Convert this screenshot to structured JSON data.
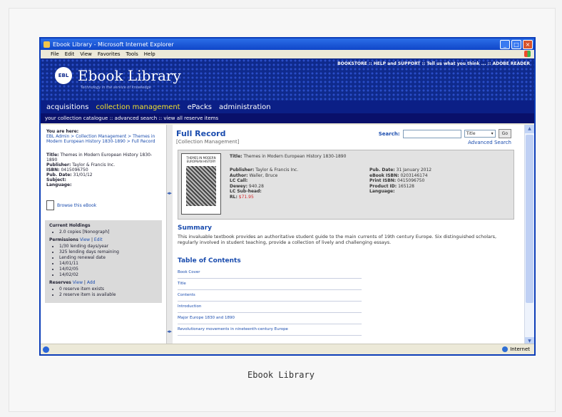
{
  "window": {
    "title": "Ebook Library - Microsoft Internet Explorer",
    "menu": [
      "File",
      "Edit",
      "View",
      "Favorites",
      "Tools",
      "Help"
    ]
  },
  "site": {
    "logo_badge": "EBL",
    "logo_name": "Ebook Library",
    "tagline": "Technology in the service of knowledge",
    "top_links": "BOOKSTORE :: HELP and SUPPORT :: Tell us what you think ... :: ADOBE READER",
    "main_nav": [
      "acquisitions",
      "collection management",
      "ePacks",
      "administration"
    ],
    "active_nav": "collection management",
    "sub_nav": "your collection catalogue :: advanced search :: view all reserve items"
  },
  "sidebar": {
    "you_are_here_label": "You are here:",
    "breadcrumb": "EBL Admin > Collection Management > Themes in Modern European History 1830-1890 > Full Record",
    "meta": [
      {
        "label": "Title:",
        "value": "Themes in Modern European History 1830-1890"
      },
      {
        "label": "Publisher:",
        "value": "Taylor & Francis Inc."
      },
      {
        "label": "ISBN:",
        "value": "0415096750"
      },
      {
        "label": "Pub. Date:",
        "value": "31/01/12"
      },
      {
        "label": "Subject:",
        "value": ""
      },
      {
        "label": "Language:",
        "value": ""
      }
    ],
    "browse_label": "Browse this eBook",
    "current_holdings_label": "Current Holdings",
    "holdings": [
      "2.0 copies [Nonograph]"
    ],
    "permissions_label": "Permissions",
    "permissions_links": [
      "View",
      "Edit"
    ],
    "permissions": [
      "1/30 lending days/year",
      "325 lending days remaining",
      "Lending renewal date",
      "14/01/11",
      "14/02/05",
      "14/02/02"
    ],
    "reserves_label": "Reserves",
    "reserves_links": [
      "View",
      "Add"
    ],
    "reserves": [
      "0 reserve item exists",
      "2 reserve item is available"
    ]
  },
  "main": {
    "heading": "Full Record",
    "subheading": "[Collection Management]",
    "search_label": "Search:",
    "search_value": "",
    "search_type": "Title",
    "go_label": "Go",
    "advanced_search": "Advanced Search",
    "record": {
      "cover_text": "THEMES IN MODERN EUROPEAN HISTORY",
      "title_label": "Title:",
      "title_value": "Themes in Modern European History 1830-1890",
      "left": [
        {
          "label": "Publisher:",
          "value": "Taylor & Francis Inc."
        },
        {
          "label": "Author:",
          "value": "Waller, Bruce"
        },
        {
          "label": "LC Call:",
          "value": ""
        },
        {
          "label": "Dewey:",
          "value": "940.28"
        },
        {
          "label": "LC Sub-head:",
          "value": ""
        },
        {
          "label": "RL:",
          "value": "$71.95"
        }
      ],
      "right": [
        {
          "label": "Pub. Date:",
          "value": "31 January 2012"
        },
        {
          "label": "eBook ISBN:",
          "value": "0203146174"
        },
        {
          "label": "Print ISBN:",
          "value": "0415096750"
        },
        {
          "label": "Product ID:",
          "value": "165128"
        },
        {
          "label": "Language:",
          "value": ""
        }
      ]
    },
    "summary_heading": "Summary",
    "summary_text": "This invaluable textbook provides an authoritative student guide to the main currents of 19th century Europe. Six distinguished scholars, regularly involved in student teaching, provide a collection of lively and challenging essays.",
    "toc_heading": "Table of Contents",
    "toc": [
      "Book Cover",
      "Title",
      "Contents",
      "Introduction",
      "Major Europe 1830 and 1890",
      "Revolutionary movements in nineteenth-century Europe"
    ]
  },
  "status": {
    "zone": "Internet"
  },
  "caption": "Ebook Library"
}
